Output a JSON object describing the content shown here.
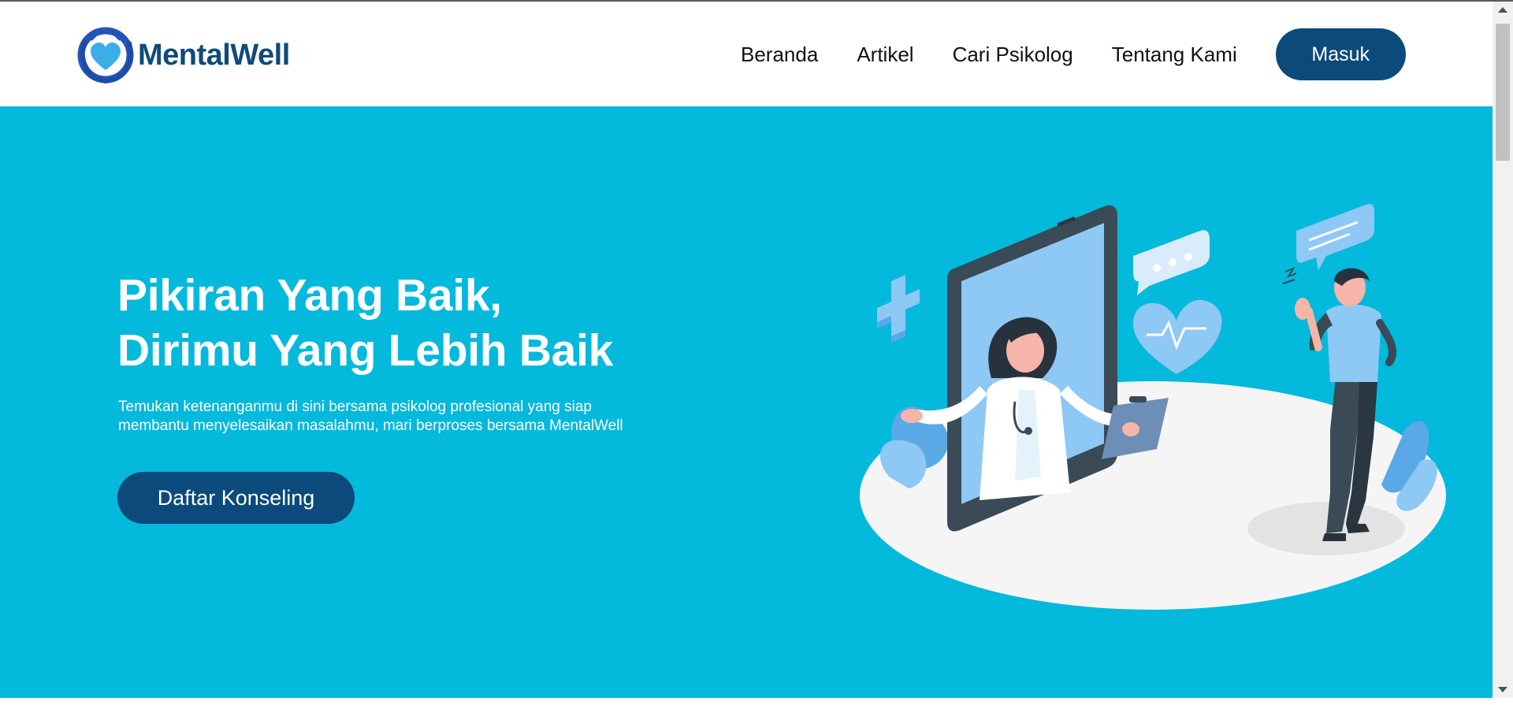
{
  "colors": {
    "brand_dark": "#0f4b7a",
    "hero_bg": "#03b9dc",
    "button_bg": "#0b4a7a",
    "logo_blue": "#2455b8",
    "logo_heart": "#3aaee8",
    "white": "#ffffff"
  },
  "brand": {
    "name": "MentalWell",
    "logo_icon": "heart-hands-logo-icon"
  },
  "nav": {
    "items": [
      "Beranda",
      "Artikel",
      "Cari Psikolog",
      "Tentang Kami"
    ],
    "login_label": "Masuk"
  },
  "hero": {
    "title_line1": "Pikiran Yang Baik,",
    "title_line2": "Dirimu Yang Lebih Baik",
    "desc_line1": "Temukan ketenanganmu di sini bersama psikolog profesional yang siap",
    "desc_line2": "membantu menyelesaikan masalahmu, mari berproses bersama MentalWell",
    "cta_label": "Daftar Konseling",
    "illustration_icon": "online-psychologist-consultation-illustration"
  }
}
